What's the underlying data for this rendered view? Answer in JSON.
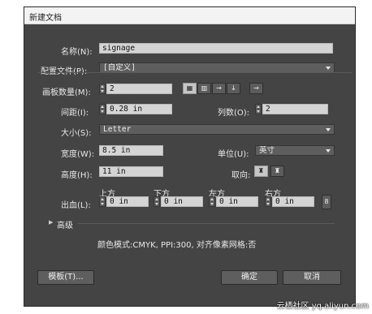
{
  "dialog": {
    "title": "新建文档"
  },
  "name": {
    "label": "名称(N):",
    "value": "signage"
  },
  "profile": {
    "label": "配置文件(P):",
    "value": "[自定义]"
  },
  "artboards": {
    "count_label": "画板数量(M):",
    "count_value": "2",
    "layout_icons": [
      "grid-by-row-icon",
      "grid-by-column-icon",
      "arrange-by-row-icon",
      "arrange-by-column-icon",
      "right-to-left-icon"
    ],
    "spacing_label": "间距(I):",
    "spacing_value": "0.28 in",
    "columns_label": "列数(O):",
    "columns_value": "2"
  },
  "size": {
    "label": "大小(S):",
    "value": "Letter"
  },
  "width": {
    "label": "宽度(W):",
    "value": "8.5 in"
  },
  "units": {
    "label": "单位(U):",
    "value": "英寸"
  },
  "height": {
    "label": "高度(H):",
    "value": "11 in"
  },
  "orientation": {
    "label": "取向:",
    "icons": [
      "portrait-icon",
      "landscape-icon"
    ],
    "active": "portrait"
  },
  "bleed": {
    "label": "出血(L):",
    "top_label": "上方",
    "top_value": "0 in",
    "bottom_label": "下方",
    "bottom_value": "0 in",
    "left_label": "左方",
    "left_value": "0 in",
    "right_label": "右方",
    "right_value": "0 in",
    "link_icon": "chain-link-icon"
  },
  "advanced": {
    "label": "高级",
    "icon": "disclosure-triangle-icon"
  },
  "info": {
    "text": "颜色模式:CMYK, PPI:300, 对齐像素网格:否"
  },
  "buttons": {
    "templates": "模板(T)...",
    "ok": "确定",
    "cancel": "取消"
  },
  "watermark": "云栖社区 yq.aliyun.com",
  "colors": {
    "dialog_bg": "#444444",
    "field_bg": "#d4d4d4",
    "titlebar_bg": "#f3f3f3"
  }
}
